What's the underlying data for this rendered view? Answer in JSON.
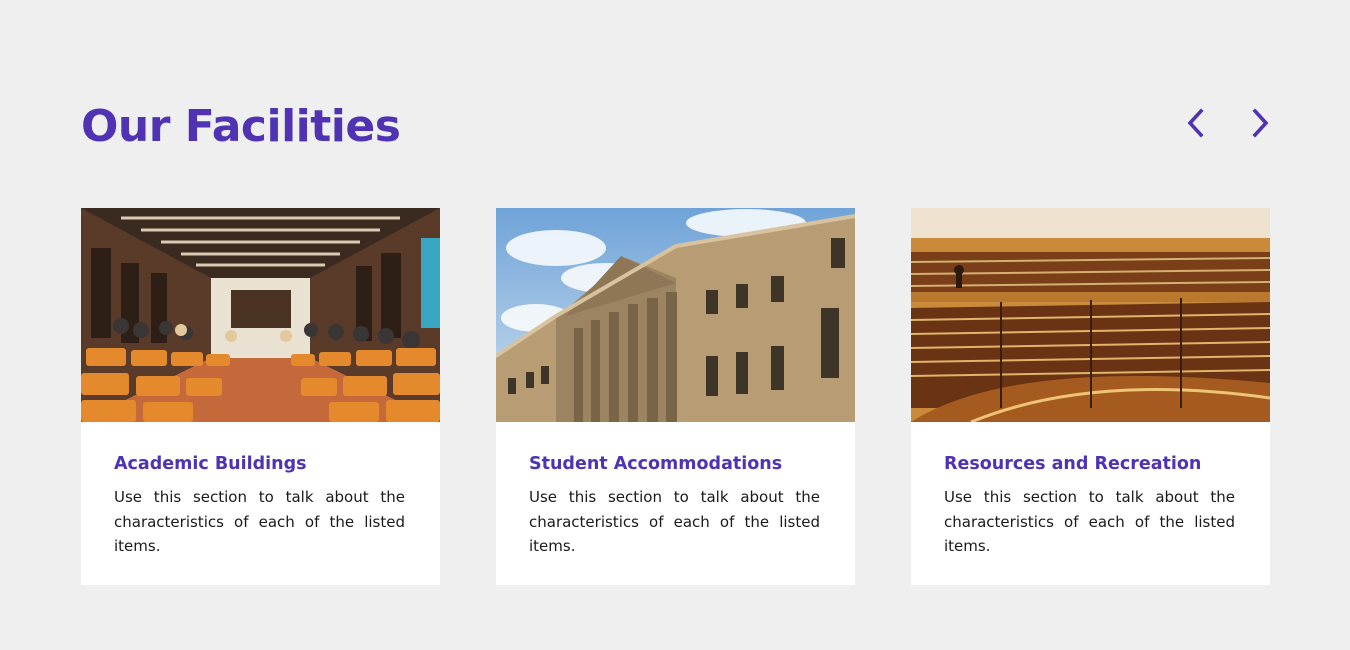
{
  "section": {
    "title": "Our Facilities",
    "prev_icon": "chevron-left-icon",
    "next_icon": "chevron-right-icon"
  },
  "cards": [
    {
      "title": "Academic Buildings",
      "text": "Use this section to talk about the characteristics of each of the listed items.",
      "image": "lecture-hall-photo"
    },
    {
      "title": "Student Accommodations",
      "text": "Use this section to talk about the characteristics of each of the listed items.",
      "image": "historic-building-photo"
    },
    {
      "title": "Resources and Recreation",
      "text": "Use this section to talk about the characteristics of each of the listed items.",
      "image": "library-photo"
    }
  ],
  "colors": {
    "accent": "#4f33b3",
    "background": "#efefef",
    "card": "#ffffff",
    "text": "#1a1a1a"
  }
}
